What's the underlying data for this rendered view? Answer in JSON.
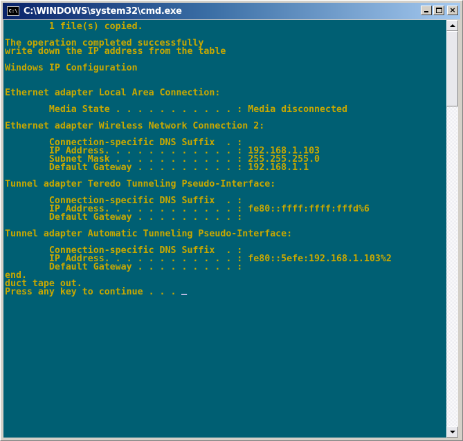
{
  "window": {
    "title": "C:\\WINDOWS\\system32\\cmd.exe",
    "icon_label": "C:\\",
    "icon": "console-icon",
    "controls": {
      "minimize": "minimize-icon",
      "maximize": "maximize-icon",
      "close": "×"
    }
  },
  "colors": {
    "console_background": "#005f73",
    "console_text": "#c8a800",
    "titlebar_start": "#0a246a",
    "titlebar_end": "#a6caf0"
  },
  "console": {
    "lines": [
      "        1 file(s) copied.",
      "",
      "The operation completed successfully",
      "write down the IP address from the table",
      "",
      "Windows IP Configuration",
      "",
      "",
      "Ethernet adapter Local Area Connection:",
      "",
      "        Media State . . . . . . . . . . . : Media disconnected",
      "",
      "Ethernet adapter Wireless Network Connection 2:",
      "",
      "        Connection-specific DNS Suffix  . :",
      "        IP Address. . . . . . . . . . . . : 192.168.1.103",
      "        Subnet Mask . . . . . . . . . . . : 255.255.255.0",
      "        Default Gateway . . . . . . . . . : 192.168.1.1",
      "",
      "Tunnel adapter Teredo Tunneling Pseudo-Interface:",
      "",
      "        Connection-specific DNS Suffix  . :",
      "        IP Address. . . . . . . . . . . . : fe80::ffff:ffff:fffd%6",
      "        Default Gateway . . . . . . . . . :",
      "",
      "Tunnel adapter Automatic Tunneling Pseudo-Interface:",
      "",
      "        Connection-specific DNS Suffix  . :",
      "        IP Address. . . . . . . . . . . . : fe80::5efe:192.168.1.103%2",
      "        Default Gateway . . . . . . . . . :",
      "end.",
      "duct tape out.",
      "Press any key to continue . . . "
    ]
  },
  "scrollbar": {
    "position": 0,
    "visible_fraction": 0.19
  }
}
